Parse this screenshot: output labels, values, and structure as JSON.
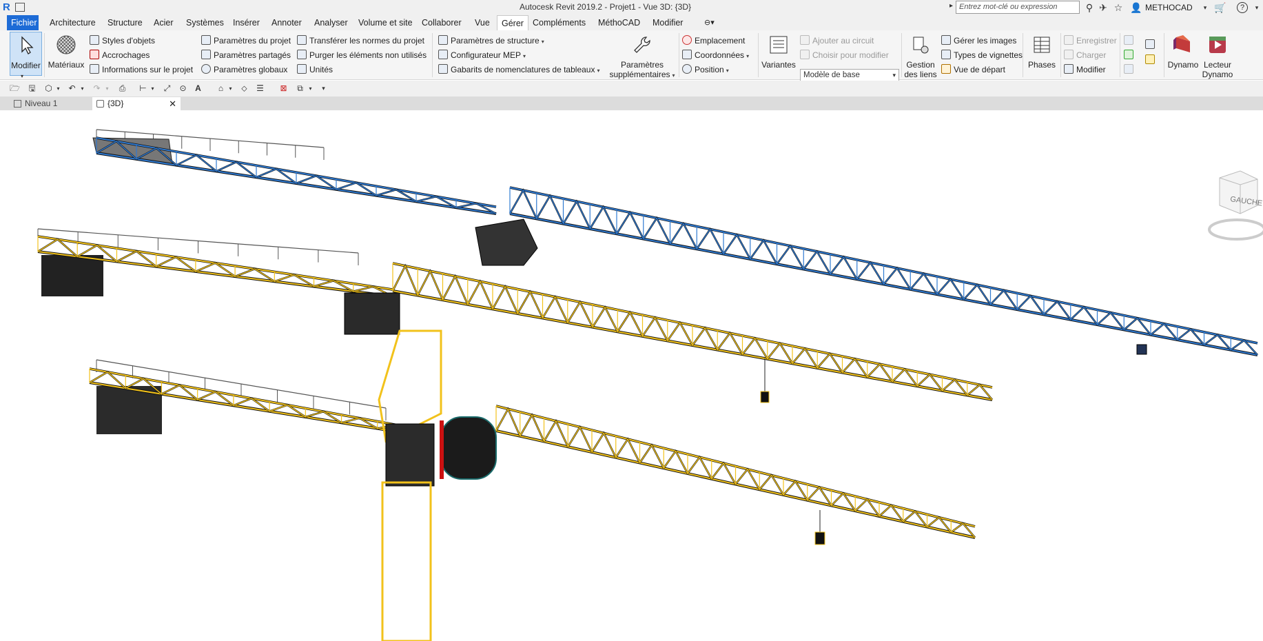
{
  "titlebar": {
    "title": "Autocesk Revit 2019.2 - Projet1 - Vue 3D: {3D}",
    "search_placeholder": "Entrez mot-clé ou expression",
    "user": "METHOCAD",
    "help": "?"
  },
  "tabs": [
    "Fichier",
    "Architecture",
    "Structure",
    "Acier",
    "Systèmes",
    "Insérer",
    "Annoter",
    "Analyser",
    "Volume et site",
    "Collaborer",
    "Vue",
    "Gérer",
    "Compléments",
    "MéthoCAD",
    "Modifier"
  ],
  "active_tab": "Gérer",
  "ribbon": {
    "modifier": "Modifier",
    "materiaux": "Matériaux",
    "styles_objets": "Styles d'objets",
    "accrochages": "Accrochages",
    "info_projet": "Informations sur le projet",
    "param_projet": "Paramètres du projet",
    "param_partages": "Paramètres partagés",
    "param_globaux": "Paramètres globaux",
    "transferer": "Transférer les normes du projet",
    "purger": "Purger les éléments non utilisés",
    "unites": "Unités",
    "param_structure": "Paramètres de structure",
    "config_mep": "Configurateur MEP",
    "gabarits": "Gabarits de nomenclatures de tableaux",
    "param_supp_1": "Paramètres",
    "param_supp_2": "supplémentaires",
    "emplacement": "Emplacement",
    "coordonnees": "Coordonnées",
    "position": "Position",
    "variantes": "Variantes",
    "ajouter_circuit": "Ajouter au circuit",
    "choisir_modifier": "Choisir pour modifier",
    "modele_base": "Modèle de base",
    "gestion_liens_1": "Gestion",
    "gestion_liens_2": "des liens",
    "gerer_images": "Gérer les images",
    "types_vignettes": "Types de vignettes",
    "vue_depart": "Vue de départ",
    "phases": "Phases",
    "enregistrer": "Enregistrer",
    "charger": "Charger",
    "modifier_small": "Modifier",
    "dynamo": "Dynamo",
    "lecteur_1": "Lecteur",
    "lecteur_2": "Dynamo"
  },
  "doc_tabs": {
    "niveau": "Niveau 1",
    "view3d": "{3D}"
  },
  "viewcube_label": "GAUCHE",
  "colors": {
    "accent": "#1d6bd6",
    "crane_blue": "#2f7ad1",
    "crane_yellow": "#f2c21b"
  }
}
